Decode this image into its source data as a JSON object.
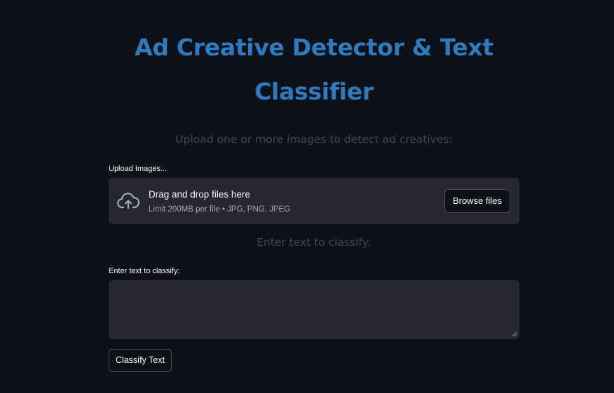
{
  "header": {
    "title": "Ad Creative Detector & Text Classifier"
  },
  "image_section": {
    "subtitle": "Upload one or more images to detect ad creatives:",
    "uploader_label": "Upload Images...",
    "dropzone_title": "Drag and drop files here",
    "dropzone_limit": "Limit 200MB per file • JPG, PNG, JPEG",
    "browse_label": "Browse files",
    "icon": "cloud-upload-icon"
  },
  "text_section": {
    "subtitle": "Enter text to classify:",
    "input_label": "Enter text to classify:",
    "input_value": "",
    "classify_label": "Classify Text"
  },
  "colors": {
    "background": "#0e1117",
    "title": "#2e7bbf",
    "subtitle": "#374a5e",
    "panel": "#262730",
    "text": "#fafafa"
  }
}
